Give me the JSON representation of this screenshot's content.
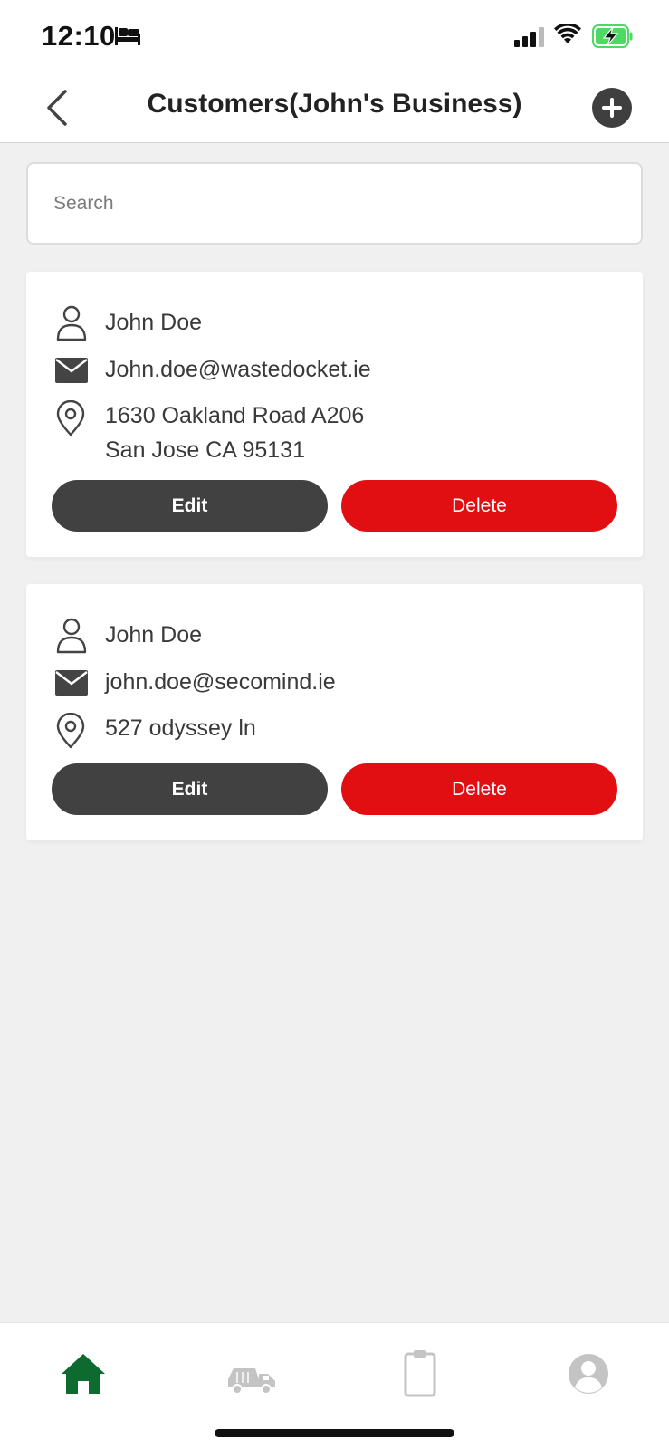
{
  "status_bar": {
    "time": "12:10",
    "battery_color": "#4cd964"
  },
  "header": {
    "title": "Customers(John's Business)"
  },
  "search": {
    "placeholder": "Search"
  },
  "customers": [
    {
      "name": "John Doe",
      "email": "John.doe@wastedocket.ie",
      "address_line1": "1630 Oakland Road A206",
      "address_line2": "San Jose CA 95131",
      "edit_label": "Edit",
      "delete_label": "Delete"
    },
    {
      "name": "John Doe",
      "email": "john.doe@secomind.ie",
      "address_line1": "527 odyssey ln",
      "edit_label": "Edit",
      "delete_label": "Delete"
    }
  ],
  "tab_bar": {
    "items": [
      {
        "icon": "home-icon",
        "active": true
      },
      {
        "icon": "skip-truck-icon",
        "active": false
      },
      {
        "icon": "clipboard-icon",
        "active": false
      },
      {
        "icon": "profile-icon",
        "active": false
      }
    ],
    "active_color": "#0e6b2f",
    "inactive_color": "#c4c4c4"
  },
  "colors": {
    "delete": "#e20f12",
    "edit": "#414141"
  }
}
